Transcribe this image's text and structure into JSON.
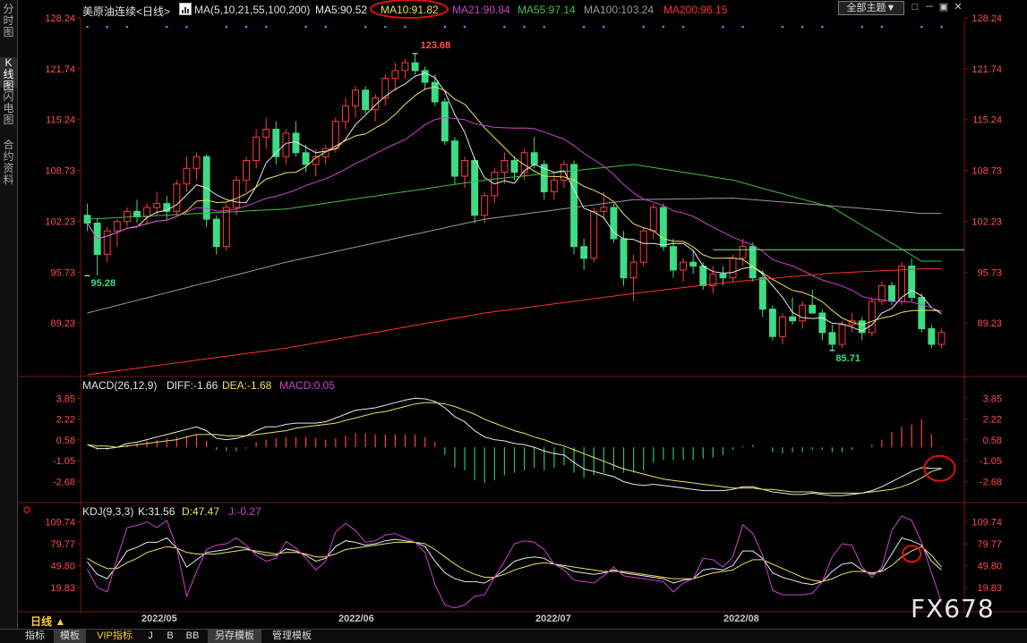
{
  "sidebar": {
    "tabs": [
      "分时图",
      "K线图",
      "闪电图",
      "合约资料"
    ],
    "active": 1
  },
  "header": {
    "title": "美原油连续<日线>",
    "ma_prefix": "MA(5,10,21,55,100,200)",
    "ma_values": [
      {
        "text": "MA5:90.52",
        "color": "#e8e8e8"
      },
      {
        "text": "MA10:91.82",
        "color": "#f0e060"
      },
      {
        "text": "MA21:90.84",
        "color": "#d040d0"
      },
      {
        "text": "MA55:97.14",
        "color": "#40c040"
      },
      {
        "text": "MA100:103.24",
        "color": "#9a9a9a"
      },
      {
        "text": "MA200:96.15",
        "color": "#ff3030"
      }
    ],
    "theme_button": "全部主题▼",
    "window_buttons": [
      "□",
      "－",
      "▣",
      "✕"
    ]
  },
  "macd_header": {
    "name": "MACD(26,12,9)",
    "diff": "DIFF:-1.66",
    "dea": "DEA:-1.68",
    "macd": "MACD:0.05"
  },
  "kdj_header": {
    "name": "KDJ(9,3,3)",
    "k": "K:31.56",
    "d": "D:47.47",
    "j": "J:-0.27"
  },
  "x_axis": {
    "labels": [
      "2022/05",
      "2022/06",
      "2022/07",
      "2022/08"
    ]
  },
  "period_label": "日线 ▲",
  "bottom_tabs": [
    "指标",
    "模板",
    "VIP指标",
    "J",
    "B",
    "BB",
    "另存模板",
    "管理模板"
  ],
  "watermark": "FX678",
  "chart_data": [
    {
      "type": "candlestick",
      "title": "美原油连续<日线>",
      "y_ticks": [
        128.24,
        121.74,
        115.24,
        108.73,
        102.23,
        95.73,
        89.23
      ],
      "ylim": [
        82.5,
        128.24
      ],
      "annotations": [
        {
          "text": "123.68",
          "value": 123.68,
          "kind": "high"
        },
        {
          "text": "95.28",
          "value": 95.28,
          "kind": "low"
        },
        {
          "text": "85.71",
          "value": 85.71,
          "kind": "low"
        }
      ],
      "ohlc": [
        [
          103.0,
          104.5,
          101.0,
          102.0
        ],
        [
          102.0,
          102.5,
          95.3,
          98.0
        ],
        [
          98.0,
          101.5,
          97.0,
          101.0
        ],
        [
          101.0,
          102.5,
          99.0,
          102.2
        ],
        [
          102.2,
          104.0,
          101.5,
          103.5
        ],
        [
          103.5,
          105.0,
          102.0,
          102.8
        ],
        [
          102.8,
          104.5,
          101.8,
          104.0
        ],
        [
          104.0,
          106.0,
          103.0,
          104.5
        ],
        [
          104.5,
          105.5,
          102.5,
          103.5
        ],
        [
          103.5,
          107.5,
          103.0,
          107.0
        ],
        [
          107.0,
          110.5,
          106.0,
          109.0
        ],
        [
          109.0,
          111.0,
          107.5,
          110.5
        ],
        [
          110.5,
          110.8,
          101.5,
          102.5
        ],
        [
          102.5,
          103.0,
          98.0,
          99.0
        ],
        [
          99.0,
          104.5,
          98.5,
          104.0
        ],
        [
          104.0,
          108.0,
          103.0,
          107.5
        ],
        [
          107.5,
          110.5,
          106.0,
          110.0
        ],
        [
          110.0,
          114.0,
          109.0,
          113.0
        ],
        [
          113.0,
          115.5,
          111.5,
          114.0
        ],
        [
          114.0,
          115.0,
          109.5,
          110.5
        ],
        [
          110.5,
          114.0,
          109.5,
          113.5
        ],
        [
          113.5,
          115.0,
          110.5,
          111.0
        ],
        [
          111.0,
          112.0,
          108.5,
          109.5
        ],
        [
          109.5,
          111.5,
          108.0,
          110.5
        ],
        [
          110.5,
          112.0,
          109.5,
          111.5
        ],
        [
          111.5,
          115.5,
          111.0,
          115.0
        ],
        [
          115.0,
          118.0,
          114.0,
          117.0
        ],
        [
          117.0,
          119.5,
          115.5,
          119.0
        ],
        [
          119.0,
          119.5,
          116.0,
          116.5
        ],
        [
          116.5,
          118.5,
          115.0,
          118.0
        ],
        [
          118.0,
          121.0,
          117.0,
          120.5
        ],
        [
          120.5,
          122.5,
          119.0,
          121.5
        ],
        [
          121.5,
          123.0,
          120.5,
          122.5
        ],
        [
          122.5,
          123.68,
          121.0,
          121.5
        ],
        [
          121.5,
          122.0,
          119.0,
          120.0
        ],
        [
          120.0,
          121.0,
          117.0,
          117.5
        ],
        [
          117.5,
          118.0,
          112.0,
          112.5
        ],
        [
          112.5,
          113.0,
          107.0,
          108.0
        ],
        [
          108.0,
          110.5,
          106.5,
          110.0
        ],
        [
          110.0,
          110.5,
          102.0,
          103.0
        ],
        [
          103.0,
          106.0,
          102.0,
          105.5
        ],
        [
          105.5,
          109.0,
          104.5,
          108.5
        ],
        [
          108.5,
          111.0,
          107.0,
          110.0
        ],
        [
          110.0,
          110.5,
          107.5,
          108.5
        ],
        [
          108.5,
          111.5,
          107.5,
          111.0
        ],
        [
          111.0,
          113.0,
          109.0,
          109.5
        ],
        [
          109.5,
          110.0,
          105.0,
          106.0
        ],
        [
          106.0,
          108.5,
          105.0,
          107.5
        ],
        [
          107.5,
          110.0,
          106.5,
          109.5
        ],
        [
          109.5,
          110.0,
          98.0,
          99.0
        ],
        [
          99.0,
          100.0,
          96.0,
          97.5
        ],
        [
          97.5,
          104.0,
          97.0,
          103.5
        ],
        [
          103.5,
          106.0,
          102.5,
          104.0
        ],
        [
          104.0,
          104.5,
          99.5,
          100.0
        ],
        [
          100.0,
          101.0,
          94.0,
          95.0
        ],
        [
          95.0,
          98.0,
          92.0,
          97.0
        ],
        [
          97.0,
          101.5,
          96.5,
          101.0
        ],
        [
          101.0,
          104.5,
          100.0,
          104.0
        ],
        [
          104.0,
          104.5,
          98.5,
          99.0
        ],
        [
          99.0,
          100.0,
          95.0,
          96.0
        ],
        [
          96.0,
          97.5,
          94.5,
          97.0
        ],
        [
          97.0,
          98.5,
          95.5,
          96.5
        ],
        [
          96.5,
          97.0,
          93.5,
          94.0
        ],
        [
          94.0,
          96.5,
          93.0,
          95.5
        ],
        [
          95.5,
          96.5,
          94.0,
          95.0
        ],
        [
          95.0,
          98.0,
          94.5,
          97.5
        ],
        [
          97.5,
          100.0,
          96.5,
          99.0
        ],
        [
          99.0,
          99.5,
          94.5,
          95.0
        ],
        [
          95.0,
          96.0,
          90.0,
          91.0
        ],
        [
          91.0,
          91.5,
          87.0,
          87.5
        ],
        [
          87.5,
          90.5,
          86.5,
          90.0
        ],
        [
          90.0,
          92.5,
          89.0,
          89.5
        ],
        [
          89.5,
          92.0,
          88.5,
          91.5
        ],
        [
          91.5,
          93.5,
          90.5,
          90.5
        ],
        [
          90.5,
          91.0,
          87.0,
          88.0
        ],
        [
          88.0,
          89.0,
          85.71,
          86.5
        ],
        [
          86.5,
          89.5,
          86.0,
          89.0
        ],
        [
          89.0,
          90.5,
          88.0,
          89.5
        ],
        [
          89.5,
          90.0,
          87.0,
          88.0
        ],
        [
          88.0,
          92.5,
          87.5,
          92.0
        ],
        [
          92.0,
          94.5,
          91.5,
          94.0
        ],
        [
          94.0,
          94.5,
          91.5,
          92.0
        ],
        [
          92.0,
          97.0,
          91.5,
          96.5
        ],
        [
          96.5,
          97.5,
          92.0,
          92.5
        ],
        [
          92.5,
          93.0,
          88.0,
          88.5
        ],
        [
          88.5,
          89.0,
          86.0,
          86.5
        ],
        [
          86.5,
          88.5,
          86.0,
          88.0
        ]
      ],
      "ma_series": [
        {
          "name": "MA5",
          "color": "#e8e8e8",
          "period": 5
        },
        {
          "name": "MA10",
          "color": "#f0e060",
          "period": 10
        },
        {
          "name": "MA21",
          "color": "#d040d0",
          "period": 21
        },
        {
          "name": "MA55",
          "color": "#40c040",
          "values": [
            [
              0,
              102.5
            ],
            [
              20,
              103.8
            ],
            [
              40,
              107.5
            ],
            [
              55,
              109.5
            ],
            [
              65,
              107.5
            ],
            [
              75,
              104.0
            ],
            [
              84,
              97.14
            ]
          ]
        },
        {
          "name": "MA100",
          "color": "#9a9a9a",
          "values": [
            [
              0,
              90.5
            ],
            [
              20,
              97.0
            ],
            [
              40,
              102.5
            ],
            [
              55,
              105.0
            ],
            [
              65,
              105.2
            ],
            [
              75,
              104.2
            ],
            [
              84,
              103.24
            ]
          ]
        },
        {
          "name": "MA200",
          "color": "#ff3030",
          "values": [
            [
              0,
              82.6
            ],
            [
              20,
              86.0
            ],
            [
              40,
              90.5
            ],
            [
              55,
              93.0
            ],
            [
              65,
              94.5
            ],
            [
              75,
              95.6
            ],
            [
              84,
              96.15
            ]
          ]
        }
      ],
      "horizontal_lines": [
        {
          "value": 98.6,
          "from": 63,
          "color": "#88dd88"
        }
      ]
    },
    {
      "type": "macd",
      "title": "MACD(26,12,9)",
      "y_ticks": [
        3.85,
        2.22,
        0.58,
        -1.05,
        -2.68
      ],
      "ylim": [
        -4.2,
        4.5
      ],
      "diff": [
        0.2,
        -0.1,
        -0.1,
        0.0,
        0.3,
        0.4,
        0.6,
        0.8,
        1.0,
        1.2,
        1.4,
        1.6,
        1.3,
        0.7,
        0.6,
        0.7,
        0.9,
        1.3,
        1.6,
        1.6,
        1.8,
        1.9,
        1.9,
        1.9,
        2.0,
        2.3,
        2.6,
        2.9,
        3.0,
        3.1,
        3.3,
        3.5,
        3.7,
        3.85,
        3.8,
        3.6,
        3.1,
        2.4,
        2.0,
        1.3,
        0.8,
        0.6,
        0.5,
        0.3,
        0.2,
        0.0,
        -0.3,
        -0.5,
        -0.6,
        -1.2,
        -1.7,
        -1.9,
        -2.1,
        -2.3,
        -2.7,
        -2.9,
        -3.0,
        -2.9,
        -3.0,
        -3.1,
        -3.2,
        -3.3,
        -3.4,
        -3.4,
        -3.4,
        -3.3,
        -3.1,
        -3.1,
        -3.3,
        -3.5,
        -3.6,
        -3.7,
        -3.7,
        -3.6,
        -3.7,
        -3.8,
        -3.8,
        -3.7,
        -3.6,
        -3.4,
        -3.1,
        -2.7,
        -2.3,
        -1.9,
        -1.6,
        -1.66,
        -1.66
      ],
      "dea": [
        0.2,
        0.1,
        0.1,
        0.0,
        0.1,
        0.2,
        0.3,
        0.4,
        0.5,
        0.6,
        0.8,
        1.0,
        1.0,
        1.0,
        0.9,
        0.9,
        0.9,
        1.0,
        1.1,
        1.2,
        1.3,
        1.5,
        1.6,
        1.7,
        1.8,
        1.9,
        2.1,
        2.3,
        2.5,
        2.7,
        2.8,
        3.0,
        3.2,
        3.4,
        3.5,
        3.5,
        3.4,
        3.2,
        2.9,
        2.6,
        2.2,
        1.9,
        1.6,
        1.3,
        1.1,
        0.8,
        0.6,
        0.3,
        0.1,
        -0.2,
        -0.5,
        -0.8,
        -1.1,
        -1.4,
        -1.7,
        -1.9,
        -2.1,
        -2.3,
        -2.5,
        -2.6,
        -2.7,
        -2.8,
        -2.9,
        -3.0,
        -3.1,
        -3.2,
        -3.2,
        -3.2,
        -3.3,
        -3.3,
        -3.4,
        -3.5,
        -3.5,
        -3.5,
        -3.6,
        -3.6,
        -3.6,
        -3.6,
        -3.6,
        -3.5,
        -3.4,
        -3.3,
        -3.1,
        -2.8,
        -2.4,
        -1.9,
        -1.68
      ],
      "macd": [
        0.0,
        -0.2,
        -0.2,
        0.0,
        0.2,
        0.3,
        0.5,
        0.6,
        0.7,
        0.8,
        0.9,
        1.0,
        0.5,
        -0.2,
        -0.3,
        -0.3,
        -0.1,
        0.4,
        0.6,
        0.7,
        0.8,
        0.8,
        0.8,
        0.7,
        0.6,
        0.7,
        0.9,
        1.1,
        1.1,
        1.0,
        1.0,
        1.0,
        1.0,
        1.0,
        0.8,
        0.4,
        -0.6,
        -1.6,
        -1.8,
        -2.6,
        -2.8,
        -2.6,
        -2.2,
        -2.0,
        -1.8,
        -1.6,
        -1.8,
        -1.6,
        -1.4,
        -2.0,
        -2.4,
        -2.2,
        -2.0,
        -1.8,
        -2.0,
        -2.0,
        -1.8,
        -1.2,
        -1.0,
        -1.0,
        -1.0,
        -1.0,
        -0.9,
        -0.8,
        -0.6,
        -0.2,
        0.1,
        0.2,
        0.0,
        -0.4,
        -0.5,
        -0.4,
        -0.4,
        -0.2,
        -0.2,
        -0.4,
        -0.4,
        -0.2,
        0.0,
        0.2,
        0.6,
        1.2,
        1.6,
        1.8,
        2.2,
        1.0,
        0.05
      ]
    },
    {
      "type": "kdj",
      "title": "KDJ(9,3,3)",
      "y_ticks": [
        109.74,
        79.77,
        49.8,
        19.83
      ],
      "ylim": [
        -12,
        118
      ],
      "k": [
        55,
        38,
        32,
        50,
        70,
        75,
        82,
        82,
        88,
        74,
        48,
        58,
        68,
        70,
        72,
        76,
        74,
        68,
        64,
        64,
        73,
        70,
        64,
        56,
        60,
        76,
        84,
        82,
        78,
        80,
        84,
        86,
        84,
        82,
        76,
        56,
        40,
        32,
        28,
        28,
        26,
        34,
        44,
        56,
        60,
        62,
        60,
        52,
        48,
        42,
        40,
        38,
        40,
        44,
        40,
        38,
        36,
        34,
        32,
        26,
        30,
        32,
        44,
        46,
        44,
        50,
        70,
        70,
        60,
        40,
        34,
        30,
        26,
        24,
        28,
        42,
        52,
        54,
        44,
        38,
        44,
        66,
        88,
        84,
        78,
        56,
        44
      ],
      "d": [
        60,
        52,
        46,
        46,
        54,
        60,
        68,
        72,
        76,
        74,
        68,
        66,
        66,
        66,
        68,
        70,
        72,
        70,
        68,
        66,
        68,
        68,
        66,
        62,
        62,
        66,
        72,
        74,
        76,
        78,
        80,
        82,
        82,
        82,
        80,
        72,
        62,
        52,
        44,
        38,
        34,
        34,
        38,
        44,
        48,
        52,
        54,
        52,
        50,
        48,
        46,
        44,
        42,
        42,
        42,
        40,
        38,
        36,
        34,
        32,
        32,
        32,
        36,
        40,
        42,
        44,
        52,
        58,
        58,
        52,
        46,
        40,
        34,
        30,
        28,
        32,
        38,
        42,
        42,
        40,
        42,
        50,
        62,
        70,
        76,
        64,
        48
      ],
      "j": [
        45,
        20,
        14,
        60,
        102,
        105,
        110,
        102,
        112,
        74,
        8,
        42,
        72,
        78,
        80,
        88,
        78,
        64,
        56,
        60,
        83,
        74,
        60,
        44,
        56,
        96,
        108,
        98,
        82,
        84,
        92,
        94,
        88,
        82,
        68,
        24,
        -4,
        -8,
        -4,
        8,
        10,
        34,
        56,
        80,
        84,
        82,
        72,
        52,
        44,
        30,
        28,
        26,
        36,
        48,
        36,
        34,
        32,
        30,
        28,
        14,
        26,
        32,
        60,
        58,
        48,
        62,
        106,
        94,
        64,
        16,
        10,
        10,
        10,
        12,
        28,
        62,
        80,
        78,
        48,
        34,
        48,
        98,
        118,
        112,
        82,
        40,
        -0.27
      ]
    }
  ]
}
